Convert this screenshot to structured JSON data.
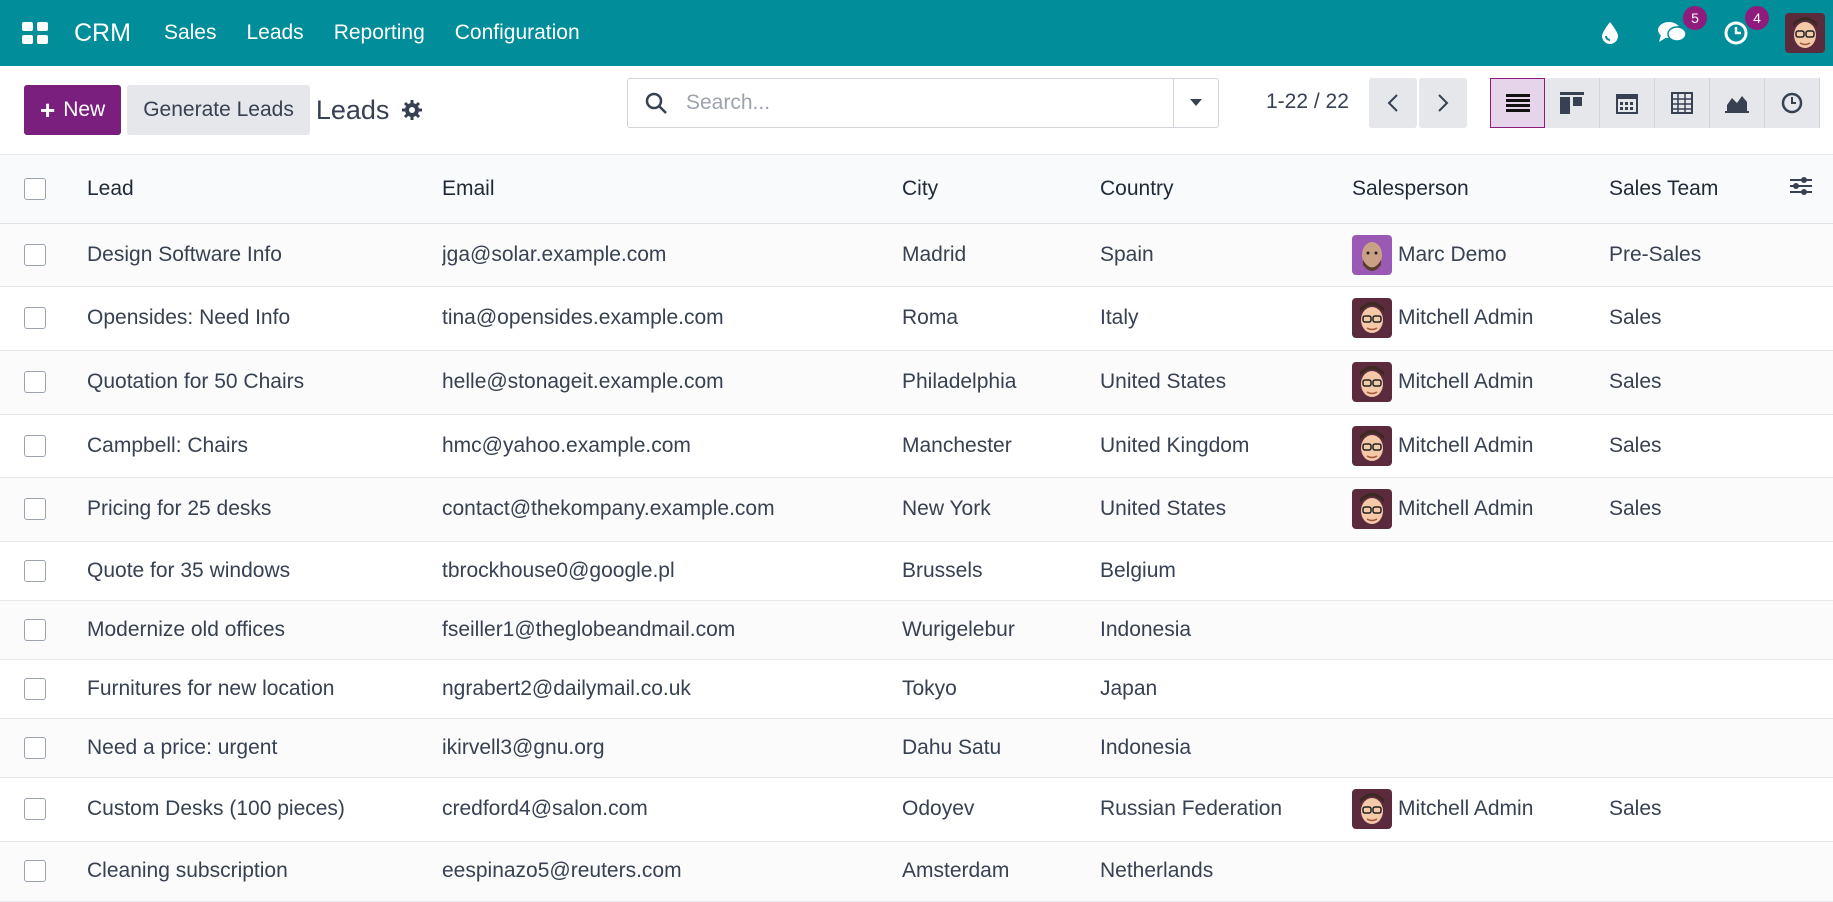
{
  "topbar": {
    "brand": "CRM",
    "menu": [
      "Sales",
      "Leads",
      "Reporting",
      "Configuration"
    ],
    "messages_count": "5",
    "activities_count": "4",
    "icons": [
      "apps-grid-icon",
      "droplet-icon",
      "chat-icon",
      "clock-icon",
      "user-avatar"
    ]
  },
  "controls": {
    "new_label": "New",
    "generate_label": "Generate Leads",
    "title": "Leads",
    "search_placeholder": "Search...",
    "pager": "1-22 / 22",
    "views": [
      "list-view",
      "kanban-view",
      "calendar-view",
      "pivot-view",
      "graph-view",
      "activity-view"
    ]
  },
  "table": {
    "columns": [
      "Lead",
      "Email",
      "City",
      "Country",
      "Salesperson",
      "Sales Team"
    ],
    "rows": [
      {
        "lead": "Design Software Info",
        "email": "jga@solar.example.com",
        "city": "Madrid",
        "country": "Spain",
        "salesperson": "Marc Demo",
        "team": "Pre-Sales"
      },
      {
        "lead": "Opensides: Need Info",
        "email": "tina@opensides.example.com",
        "city": "Roma",
        "country": "Italy",
        "salesperson": "Mitchell Admin",
        "team": "Sales"
      },
      {
        "lead": "Quotation for 50 Chairs",
        "email": "helle@stonageit.example.com",
        "city": "Philadelphia",
        "country": "United States",
        "salesperson": "Mitchell Admin",
        "team": "Sales"
      },
      {
        "lead": "Campbell: Chairs",
        "email": "hmc@yahoo.example.com",
        "city": "Manchester",
        "country": "United Kingdom",
        "salesperson": "Mitchell Admin",
        "team": "Sales"
      },
      {
        "lead": "Pricing for 25 desks",
        "email": "contact@thekompany.example.com",
        "city": "New York",
        "country": "United States",
        "salesperson": "Mitchell Admin",
        "team": "Sales"
      },
      {
        "lead": "Quote for 35 windows",
        "email": "tbrockhouse0@google.pl",
        "city": "Brussels",
        "country": "Belgium",
        "salesperson": "",
        "team": ""
      },
      {
        "lead": "Modernize old offices",
        "email": "fseiller1@theglobeandmail.com",
        "city": "Wurigelebur",
        "country": "Indonesia",
        "salesperson": "",
        "team": ""
      },
      {
        "lead": "Furnitures for new location",
        "email": "ngrabert2@dailymail.co.uk",
        "city": "Tokyo",
        "country": "Japan",
        "salesperson": "",
        "team": ""
      },
      {
        "lead": "Need a price: urgent",
        "email": "ikirvell3@gnu.org",
        "city": "Dahu Satu",
        "country": "Indonesia",
        "salesperson": "",
        "team": ""
      },
      {
        "lead": "Custom Desks (100 pieces)",
        "email": "credford4@salon.com",
        "city": "Odoyev",
        "country": "Russian Federation",
        "salesperson": "Mitchell Admin",
        "team": "Sales"
      },
      {
        "lead": "Cleaning subscription",
        "email": "eespinazo5@reuters.com",
        "city": "Amsterdam",
        "country": "Netherlands",
        "salesperson": "",
        "team": ""
      }
    ]
  },
  "colors": {
    "topbar": "#018d9a",
    "primary": "#7b1f7e",
    "badge": "#8f1c7d"
  }
}
